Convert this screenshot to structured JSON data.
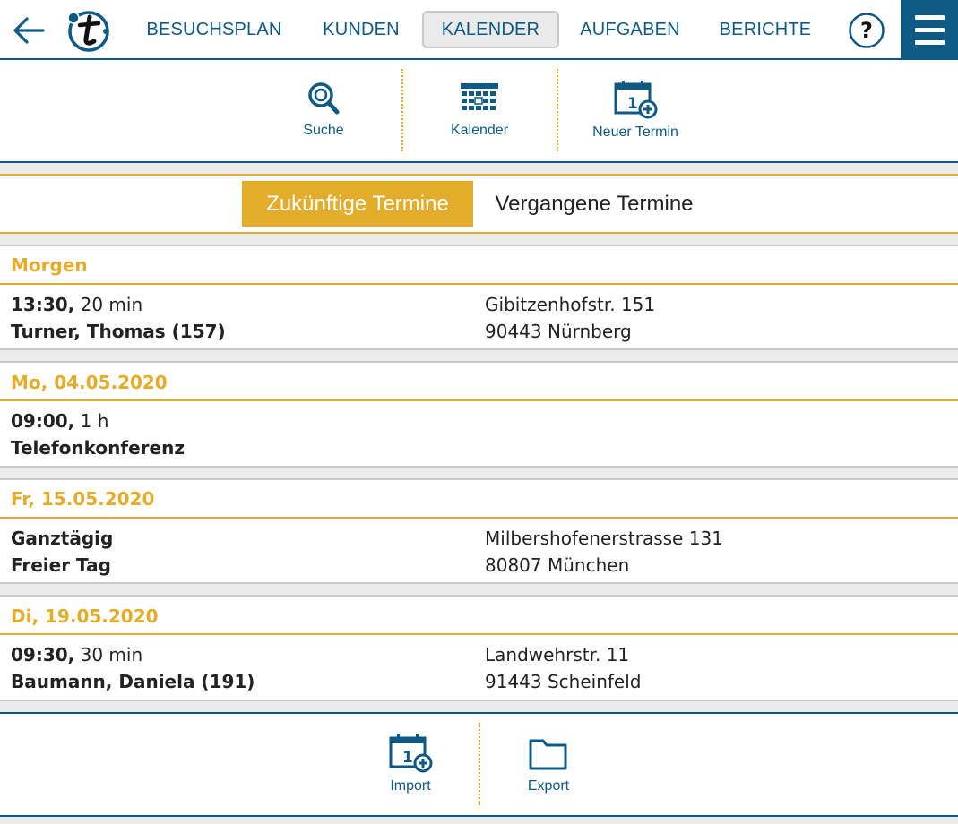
{
  "nav": {
    "items": [
      "BESUCHSPLAN",
      "KUNDEN",
      "KALENDER",
      "AUFGABEN",
      "BERICHTE"
    ],
    "active": "KALENDER",
    "help_label": "?"
  },
  "toolbar": {
    "search_label": "Suche",
    "calendar_label": "Kalender",
    "new_appointment_label": "Neuer Termin"
  },
  "tabs": {
    "future": "Zukünftige Termine",
    "past": "Vergangene Termine",
    "active": "future"
  },
  "days": [
    {
      "heading": "Morgen",
      "entry": {
        "time": "13:30,",
        "duration": "20 min",
        "title": "Turner, Thomas (157)",
        "street": "Gibitzenhofstr. 151",
        "city": "90443 Nürnberg"
      }
    },
    {
      "heading": "Mo, 04.05.2020",
      "entry": {
        "time": "09:00,",
        "duration": "1 h",
        "title": "Telefonkonferenz",
        "street": "",
        "city": ""
      }
    },
    {
      "heading": "Fr, 15.05.2020",
      "entry": {
        "time": "Ganztägig",
        "duration": "",
        "title": "Freier Tag",
        "street": "Milbershofenerstrasse 131",
        "city": "80807 München"
      }
    },
    {
      "heading": "Di, 19.05.2020",
      "entry": {
        "time": "09:30,",
        "duration": "30 min",
        "title": "Baumann, Daniela (191)",
        "street": "Landwehrstr. 11",
        "city": "91443 Scheinfeld"
      }
    }
  ],
  "bottom_toolbar": {
    "import_label": "Import",
    "export_label": "Export"
  },
  "colors": {
    "primary": "#0e5a85",
    "accent": "#e4ac2b",
    "band": "#ebebeb"
  }
}
